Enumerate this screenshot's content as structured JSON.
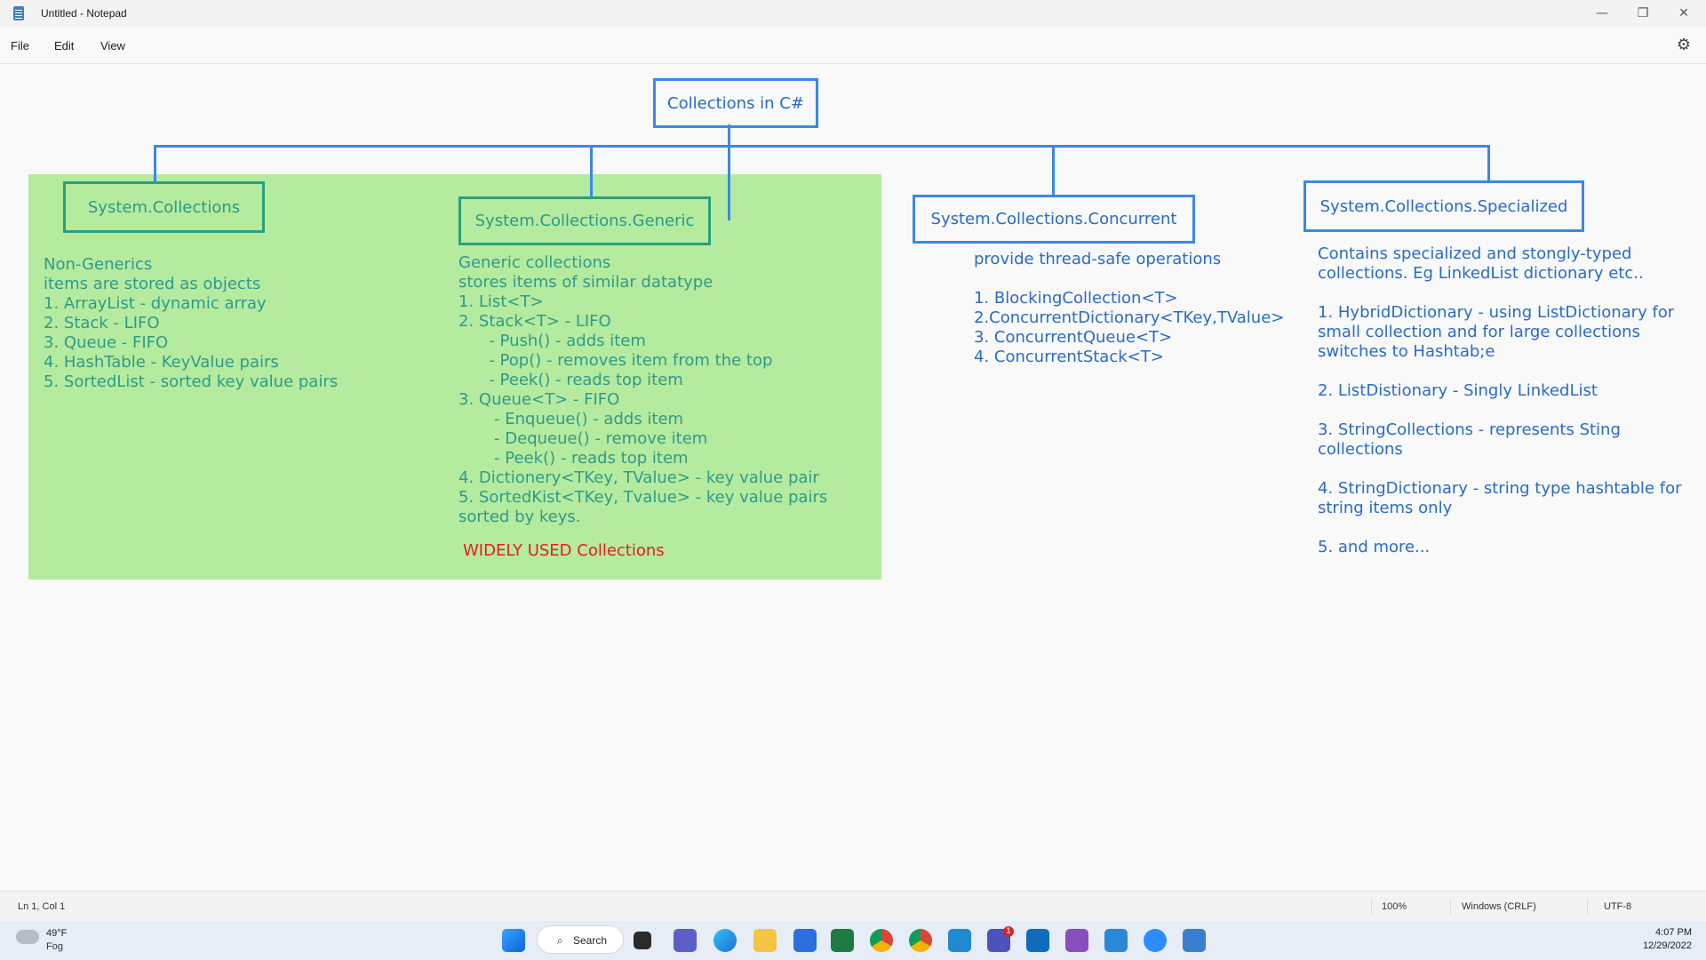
{
  "window": {
    "title": "Untitled - Notepad",
    "minimize": "—",
    "restore": "❐",
    "close": "✕"
  },
  "menu": {
    "file": "File",
    "edit": "Edit",
    "view": "View",
    "settings_icon": "gear-icon"
  },
  "diagram": {
    "root": "Collections in C#",
    "nodes": [
      {
        "label": "System.Collections"
      },
      {
        "label": "System.Collections.Generic"
      },
      {
        "label": "System.Collections.Concurrent"
      },
      {
        "label": "System.Collections.Specialized"
      }
    ],
    "collections_lines": [
      "Non-Generics",
      "items are stored as objects",
      "1. ArrayList - dynamic array",
      "2. Stack - LIFO",
      "3. Queue - FIFO",
      "4. HashTable - KeyValue pairs",
      "5. SortedList - sorted key value pairs"
    ],
    "generic_lines": [
      "Generic collections",
      "stores items of similar datatype",
      "1. List<T>",
      "2. Stack<T> - LIFO",
      "      - Push() - adds item",
      "      - Pop() - removes item from the top",
      "      - Peek() - reads top item",
      "3. Queue<T> - FIFO",
      "       - Enqueue() - adds item",
      "       - Dequeue() - remove item",
      "       - Peek() - reads top item",
      "4. Dictionery<TKey, TValue> - key value pair",
      "5. SortedKist<TKey, Tvalue> - key value pairs",
      "sorted by keys."
    ],
    "widely_used": "WIDELY USED Collections",
    "concurrent_lines": [
      "provide thread-safe operations",
      "",
      "1. BlockingCollection<T>",
      "2.ConcurrentDictionary<TKey,TValue>",
      "3. ConcurrentQueue<T>",
      "4. ConcurrentStack<T>"
    ],
    "specialized_lines": [
      "Contains specialized and stongly-typed",
      "collections. Eg LinkedList dictionary etc..",
      "",
      "1. HybridDictionary - using ListDictionary for",
      "small collection and for large collections",
      "switches to Hashtab;e",
      "",
      "2. ListDistionary - Singly LinkedList",
      "",
      "3. StringCollections - represents Sting",
      "collections",
      "",
      "4. StringDictionary - string type hashtable for",
      "string items only",
      "",
      "5. and more..."
    ]
  },
  "status": {
    "position": "Ln 1, Col 1",
    "zoom": "100%",
    "line_ending": "Windows (CRLF)",
    "encoding": "UTF-8"
  },
  "taskbar": {
    "weather_temp": "49°F",
    "weather_desc": "Fog",
    "search_label": "Search",
    "time": "4:07 PM",
    "date": "12/29/2022",
    "teams_badge": "1"
  },
  "colors": {
    "accent_blue": "#3a88ec",
    "green_fill": "#b5eb9e",
    "teal_text": "#2e9a8c",
    "red_text": "#e02020"
  }
}
